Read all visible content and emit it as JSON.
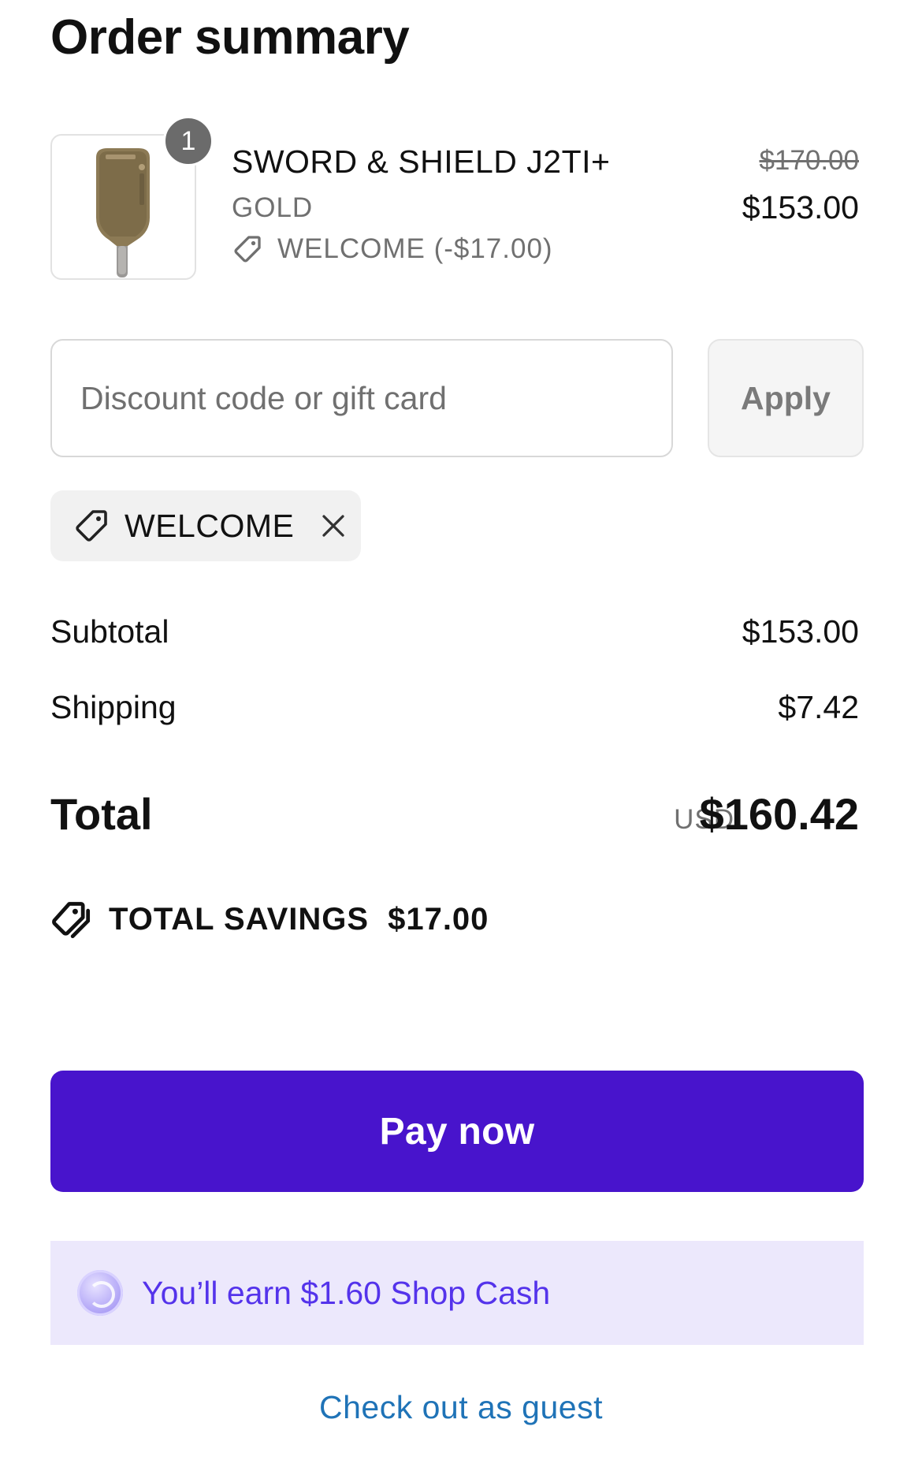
{
  "page": {
    "title": "Order summary"
  },
  "item": {
    "quantity": "1",
    "name": "SWORD & SHIELD J2TI+",
    "variant": "GOLD",
    "discount_line": "WELCOME (-$17.00)",
    "original_price": "$170.00",
    "price": "$153.00",
    "thumbnail_icon": "pickleball-paddle-image"
  },
  "discount": {
    "placeholder": "Discount code or gift card",
    "apply_label": "Apply",
    "applied_code": "WELCOME"
  },
  "summary": {
    "subtotal_label": "Subtotal",
    "subtotal_value": "$153.00",
    "shipping_label": "Shipping",
    "shipping_value": "$7.42",
    "total_label": "Total",
    "currency": "USD",
    "total_value": "$160.42",
    "savings_label": "TOTAL SAVINGS",
    "savings_value": "$17.00"
  },
  "actions": {
    "pay_label": "Pay now",
    "shop_cash_text": "You’ll earn $1.60 Shop Cash",
    "guest_label": "Check out as guest"
  },
  "colors": {
    "pay_button": "#4814cc",
    "shop_cash_bg": "#ece8fc",
    "shop_cash_text": "#5433eb",
    "link": "#1f73b7"
  }
}
